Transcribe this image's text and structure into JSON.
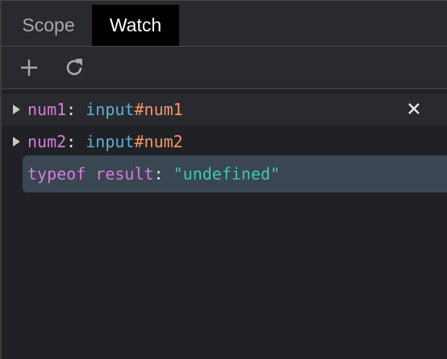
{
  "tabs": {
    "scope_label": "Scope",
    "watch_label": "Watch"
  },
  "toolbar": {
    "add_icon": "plus-icon",
    "refresh_icon": "refresh-icon"
  },
  "watch_items": [
    {
      "name": "num1",
      "separator": ": ",
      "value_type": "input",
      "value_id": "#num1",
      "expandable": true
    },
    {
      "name": "num2",
      "separator": ": ",
      "value_type": "input",
      "value_id": "#num2",
      "expandable": true
    },
    {
      "expression": "typeof result",
      "separator": ": ",
      "value": "\"undefined\"",
      "editing": true
    }
  ],
  "colors": {
    "background": "#202124",
    "panel": "#292a2d",
    "active_tab": "#000000",
    "edit_row": "#3a4651",
    "name": "#d77bdd",
    "type": "#5db0d7",
    "id": "#f29766",
    "string": "#3dc9b0"
  }
}
